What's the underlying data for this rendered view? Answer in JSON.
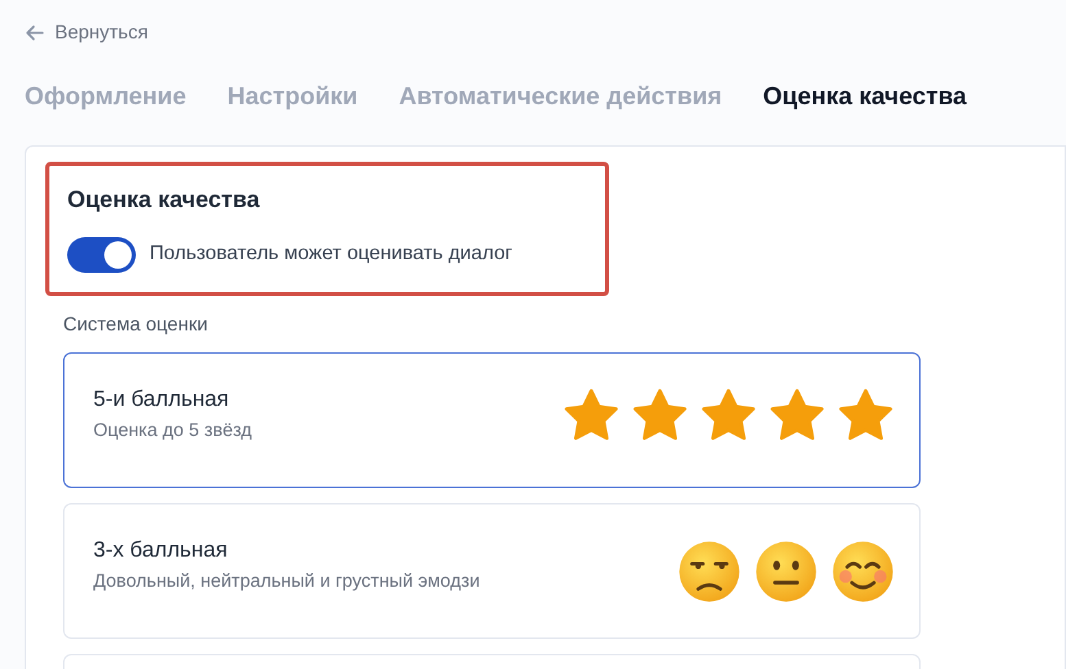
{
  "back_link": {
    "label": "Вернуться"
  },
  "tabs": [
    {
      "label": "Оформление",
      "selected": false
    },
    {
      "label": "Настройки",
      "selected": false
    },
    {
      "label": "Автоматические действия",
      "selected": false
    },
    {
      "label": "Оценка качества",
      "selected": true
    }
  ],
  "section": {
    "title": "Оценка качества",
    "highlighted": true,
    "toggle": {
      "label": "Пользователь может оценивать диалог",
      "on": true
    }
  },
  "rating_system": {
    "label": "Система оценки",
    "options": [
      {
        "kind": "stars",
        "title": "5-и балльная",
        "description": "Оценка до 5 звёзд",
        "selected": true,
        "stars": 5
      },
      {
        "kind": "emoji",
        "title": "3-х балльная",
        "description": "Довольный, нейтральный и грустный эмодзи",
        "selected": false,
        "faces": [
          {
            "kind": "unamused"
          },
          {
            "kind": "neutral"
          },
          {
            "kind": "smiling"
          }
        ]
      }
    ]
  }
}
